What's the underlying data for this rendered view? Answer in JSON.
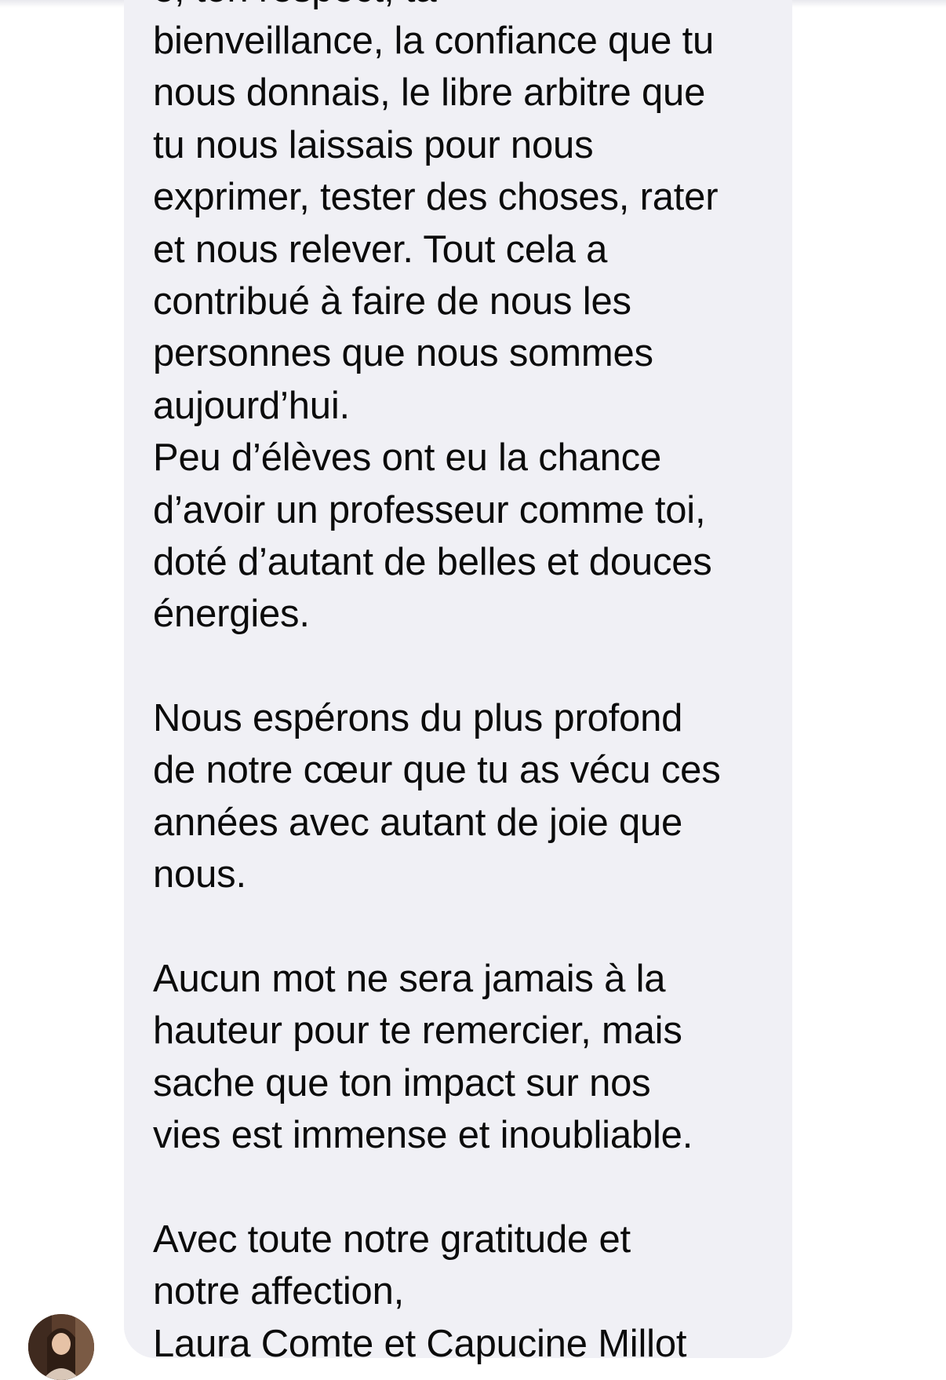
{
  "message": {
    "cut_line": "e, ton respect, ta",
    "lines": [
      "bienveillance, la confiance que tu",
      "nous donnais, le libre arbitre que",
      "tu nous laissais pour nous",
      "exprimer, tester des choses, rater",
      "et nous relever. Tout cela a",
      "contribué à faire de nous les",
      "personnes que nous sommes",
      "aujourd’hui.",
      "Peu d’élèves ont eu la chance",
      "d’avoir un professeur comme toi,",
      "doté d’autant de belles et douces",
      "énergies.",
      "",
      "Nous espérons du plus profond",
      "de notre cœur que tu as vécu ces",
      "années avec autant de joie que",
      "nous.",
      "",
      "Aucun mot ne sera jamais à la",
      "hauteur pour te remercier, mais",
      "sache que ton impact sur nos",
      "vies est immense et inoubliable.",
      "",
      "Avec toute notre gratitude et",
      "notre affection,",
      "Laura Comte et Capucine Millot"
    ]
  },
  "colors": {
    "bubble": "#f0f0f5",
    "text": "#0b0b0b",
    "background": "#ffffff"
  },
  "sender": {
    "avatar_icon": "user-photo-avatar"
  }
}
